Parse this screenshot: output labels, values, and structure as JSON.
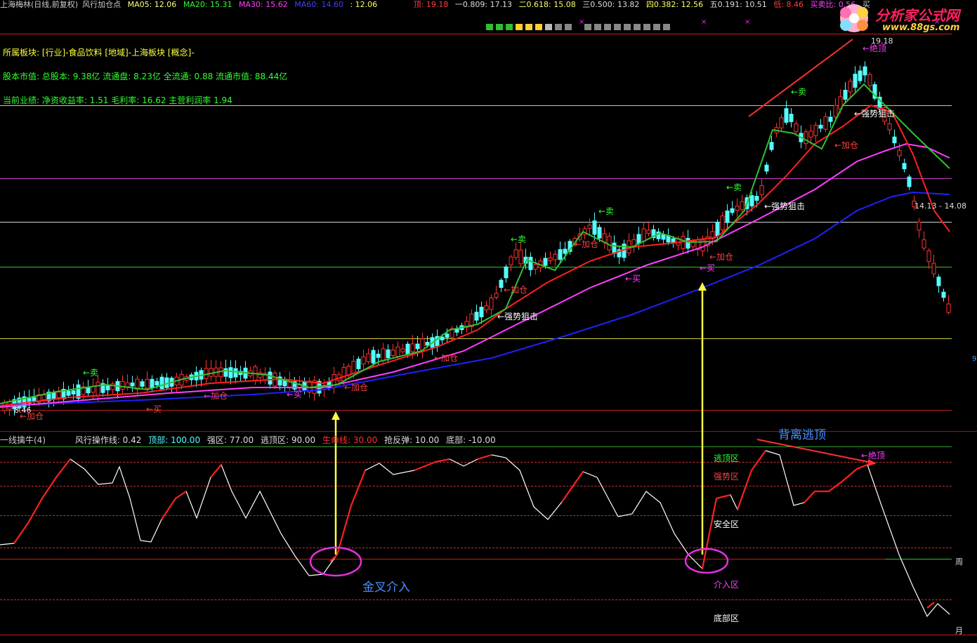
{
  "header": {
    "stock": "上海梅林(日线,前复权)",
    "indicator": "风行加仓点",
    "ma05": "MA05: 12.06",
    "ma20": "MA20: 15.31",
    "ma30": "MA30: 15.62",
    "ma60": "MA60: 14.60",
    "extra": ": 12.06",
    "ding": "顶: 19.18",
    "lv1": "一0.809: 17.13",
    "lv2": "二0.618: 15.08",
    "lv3": "三0.500: 13.82",
    "lv4": "四0.382: 12.56",
    "lv5": "五0.191: 10.51",
    "di": "低: 8.46",
    "ratio": "买卖比: 0.56",
    "buy": "买"
  },
  "info": {
    "sector": "所属板块: [行业]-食品饮料 [地域]-上海板块 [概念]-",
    "capital": "股本市值: 总股本: 9.38亿 流通盘: 8.23亿 全流通: 0.88 流通市值: 88.44亿",
    "perf": "当前业绩: 净资收益率: 1.51 毛利率: 16.62 主营利润率 1.94"
  },
  "logo": {
    "text": "分析家公式网",
    "url": "www.88gs.com"
  },
  "price_labels": {
    "low": "8.46",
    "high": "19.18",
    "range": "14.13 - 14.08",
    "nine": "9"
  },
  "signals": {
    "sell": "←卖",
    "add": "←加仓",
    "buy": "←买",
    "strong": "←强势狙击",
    "top": "←绝顶"
  },
  "sub": {
    "name": "一线擒牛(4)",
    "line": "风行操作线: 0.42",
    "top": "顶部: 100.00",
    "strong": "强区: 77.00",
    "escape": "逃顶区: 90.00",
    "life": "生命线: 30.00",
    "rebound": "抢反弹: 10.00",
    "bottom": "底部: -10.00"
  },
  "zones": {
    "escape": "逃顶区",
    "strong": "强势区",
    "safe": "安全区",
    "enter": "介入区",
    "bottom": "底部区",
    "week": "周",
    "month": "月"
  },
  "annotations": {
    "golden": "金叉介入",
    "diverge": "背离逃顶",
    "top": "←绝顶"
  },
  "colors": {
    "up": "#ff3232",
    "down": "#54ffff",
    "ma05": "#ffffff",
    "ma20": "#ff2020",
    "ma30": "#ff40ff",
    "ma60": "#2020ff",
    "green": "#30c030",
    "yellow": "#ffff30"
  }
}
